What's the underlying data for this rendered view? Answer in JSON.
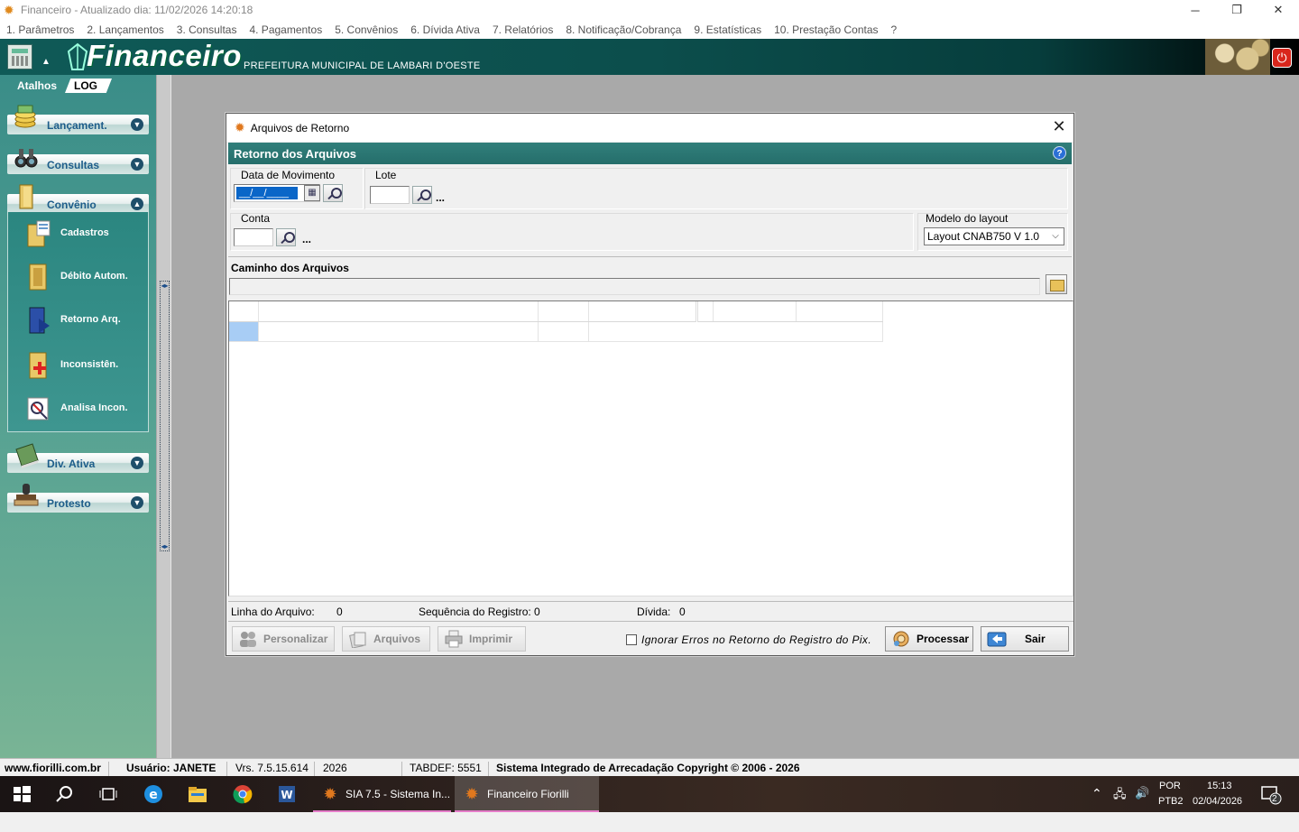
{
  "window": {
    "title": "Financeiro - Atualizado dia: 11/02/2026 14:20:18",
    "minimize": "─",
    "restore": "❐",
    "close": "✕"
  },
  "menu": [
    "1. Parâmetros",
    "2. Lançamentos",
    "3. Consultas",
    "4. Pagamentos",
    "5. Convênios",
    "6. Dívida Ativa",
    "7. Relatórios",
    "8. Notificação/Cobrança",
    "9. Estatísticas",
    "10. Prestação Contas",
    "?"
  ],
  "banner": {
    "logo": "Financeiro",
    "subtitle": "PREFEITURA MUNICIPAL DE LAMBARI D'OESTE",
    "caret": "▲",
    "power_icon": "⏻"
  },
  "sidebar": {
    "atalhos": "Atalhos",
    "log": "LOG",
    "groups": [
      {
        "label": "Lançament.",
        "icon": "coins-icon",
        "toggle": "▼"
      },
      {
        "label": "Consultas",
        "icon": "binoculars-icon",
        "toggle": "▼"
      },
      {
        "label": "Convênio",
        "icon": "folder-icon",
        "toggle": "▲"
      },
      {
        "label": "Div. Ativa",
        "icon": "book-icon",
        "toggle": "▼"
      },
      {
        "label": "Protesto",
        "icon": "stamp-icon",
        "toggle": "▼"
      }
    ],
    "convenio_items": [
      {
        "label": "Cadastros",
        "icon": "cadastros-icon"
      },
      {
        "label": "Débito Autom.",
        "icon": "debito-icon"
      },
      {
        "label": "Retorno Arq.",
        "icon": "retorno-icon"
      },
      {
        "label": "Inconsistên.",
        "icon": "inconsistencia-icon"
      },
      {
        "label": "Analisa Incon.",
        "icon": "analisa-icon"
      }
    ]
  },
  "dialog": {
    "title": "Arquivos de Retorno",
    "close": "✕",
    "header": "Retorno dos Arquivos",
    "help": "?",
    "data_movimento_label": "Data de Movimento",
    "data_movimento_value": "__/__/____",
    "calendar_glyph": "▦",
    "lote_label": "Lote",
    "lote_value": "",
    "ellipsis": "...",
    "conta_label": "Conta",
    "conta_value": "",
    "modelo_label": "Modelo do layout",
    "modelo_value": "Layout CNAB750 V 1.0",
    "combo_arrow": "⌵",
    "caminho_label": "Caminho dos Arquivos",
    "caminho_value": "",
    "status": {
      "linha_label": "Linha do Arquivo:",
      "linha_value": "0",
      "sequencia_label": "Sequência do Registro:",
      "sequencia_value": "0",
      "divida_label": "Dívida:",
      "divida_value": "0"
    },
    "buttons": {
      "personalizar": "Personalizar",
      "arquivos": "Arquivos",
      "imprimir": "Imprimir",
      "ignorar": "Ignorar Erros no Retorno do Registro do Pix.",
      "processar": "Processar",
      "sair": "Sair"
    }
  },
  "statusbar": {
    "site": "www.fiorilli.com.br",
    "usuario": "Usuário: JANETE",
    "versao": "Vrs. 7.5.15.614",
    "ano": "2026",
    "tabdef": "TABDEF: 5551",
    "copyright": "Sistema Integrado de Arrecadação Copyright © 2006 - 2026"
  },
  "taskbar": {
    "apps": [
      {
        "label": "SIA 7.5 - Sistema In...",
        "active": false
      },
      {
        "label": "Financeiro Fiorilli",
        "active": true
      }
    ],
    "lang1": "POR",
    "lang2": "PTB2",
    "time": "15:13",
    "date": "02/04/2026",
    "notifications": "2",
    "tray_chevron": "⌃",
    "network": "🖧",
    "volume": "🔊"
  }
}
